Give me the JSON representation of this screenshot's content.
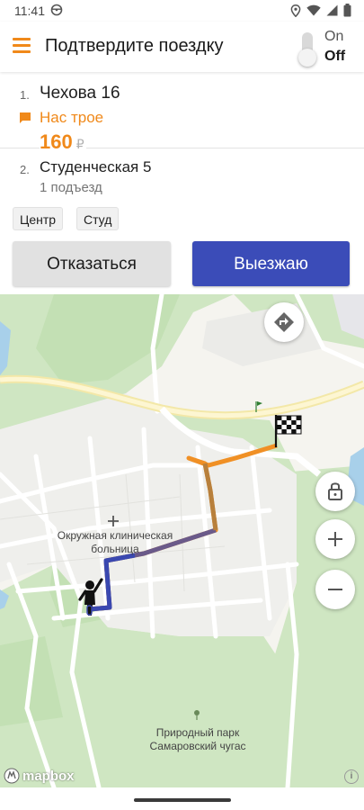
{
  "status_bar": {
    "time": "11:41"
  },
  "app_bar": {
    "title": "Подтвердите поездку",
    "toggle_on_label": "On",
    "toggle_off_label": "Off"
  },
  "trip": {
    "stops": [
      {
        "number": "1.",
        "name": "Чехова 16"
      },
      {
        "number": "2.",
        "name": "Студенческая 5",
        "detail": "1 подъезд"
      }
    ],
    "note": "Нас трое",
    "price": "160",
    "currency": "₽",
    "chips": [
      "Центр",
      "Студ"
    ]
  },
  "actions": {
    "decline_label": "Отказаться",
    "accept_label": "Выезжаю"
  },
  "map": {
    "hospital_label": "Окружная клиническая больница",
    "park_label": "Природный парк Самаровский чугас",
    "attribution": "mapbox"
  },
  "colors": {
    "accent_orange": "#f0891a",
    "primary_blue": "#3b4cb8"
  }
}
